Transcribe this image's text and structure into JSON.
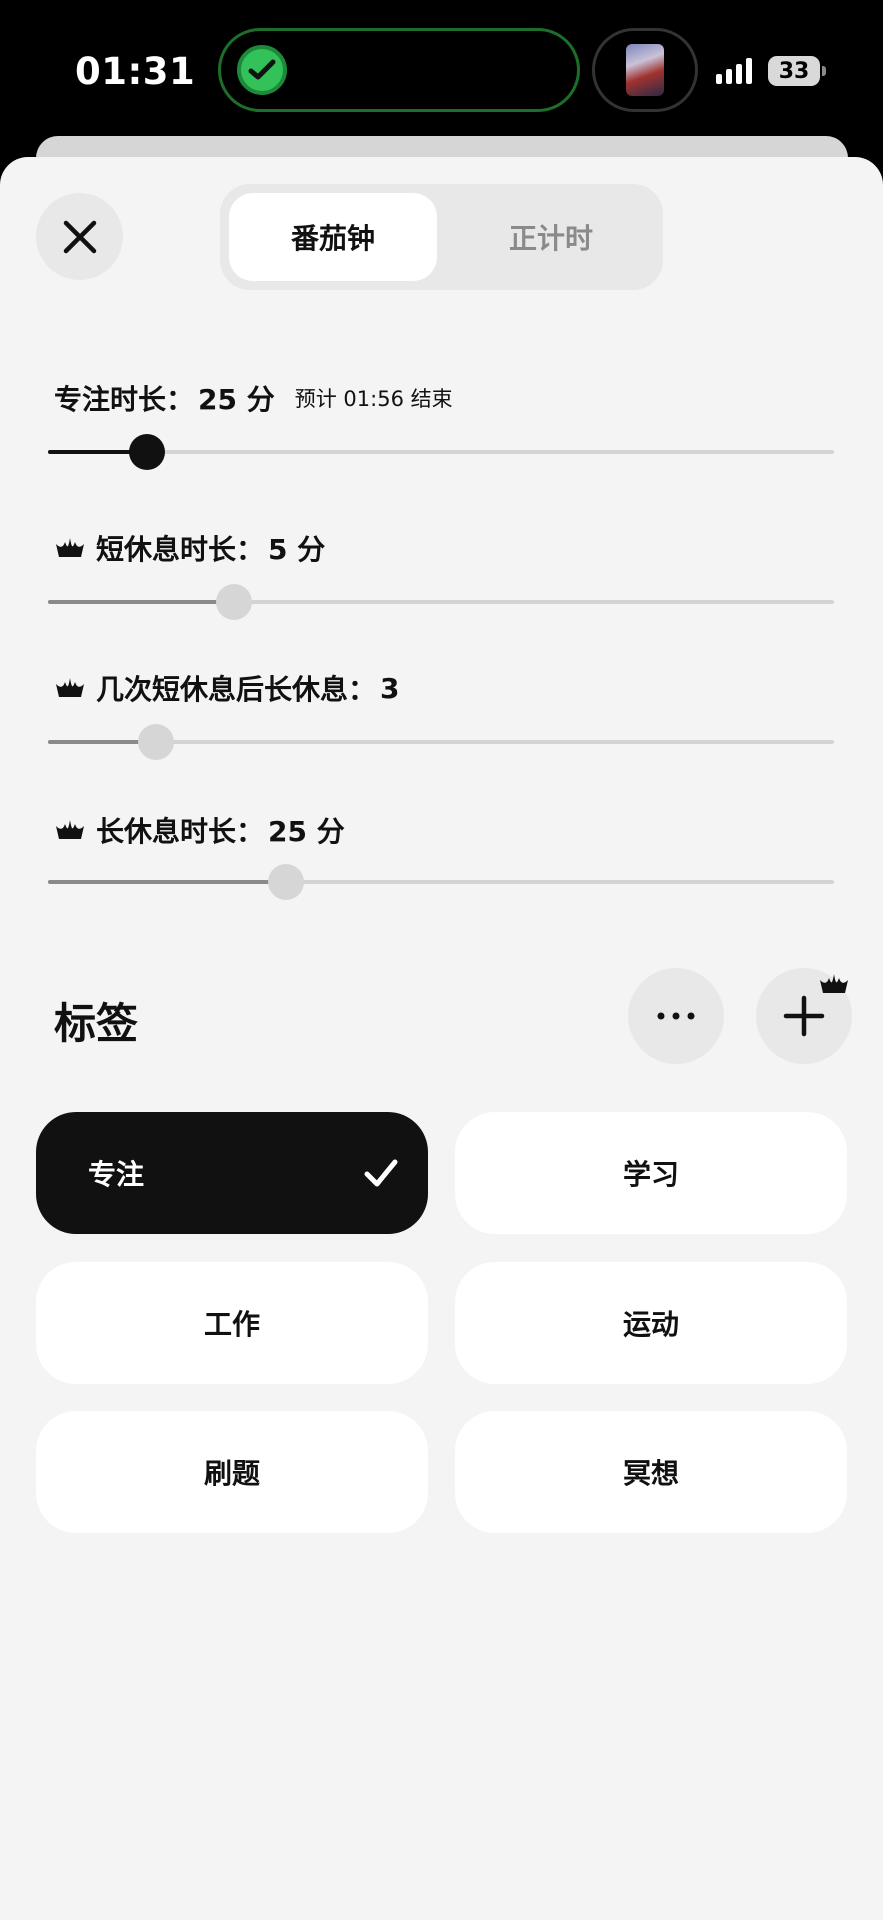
{
  "status_bar": {
    "time": "01:31",
    "battery": "33"
  },
  "header": {
    "tabs": [
      "番茄钟",
      "正计时"
    ],
    "active_tab": "番茄钟"
  },
  "settings": {
    "focus": {
      "label": "专注时长：",
      "value": "25 分",
      "note": "预计 01:56 结束",
      "level": 0.12
    },
    "short_break": {
      "label": "短休息时长：",
      "value": "5 分",
      "level": 0.24
    },
    "rounds": {
      "label": "几次短休息后长休息：",
      "value": "3",
      "level": 0.14
    },
    "long_break": {
      "label": "长休息时长：",
      "value": "25 分",
      "level": 0.3
    }
  },
  "tags": {
    "title": "标签",
    "items": [
      {
        "label": "专注",
        "selected": true
      },
      {
        "label": "学习",
        "selected": false
      },
      {
        "label": "工作",
        "selected": false
      },
      {
        "label": "运动",
        "selected": false
      },
      {
        "label": "刷题",
        "selected": false
      },
      {
        "label": "冥想",
        "selected": false
      }
    ]
  },
  "colors": {
    "accent": "#111111",
    "island_green": "#33c15a",
    "sheet_bg": "#f4f4f4"
  }
}
